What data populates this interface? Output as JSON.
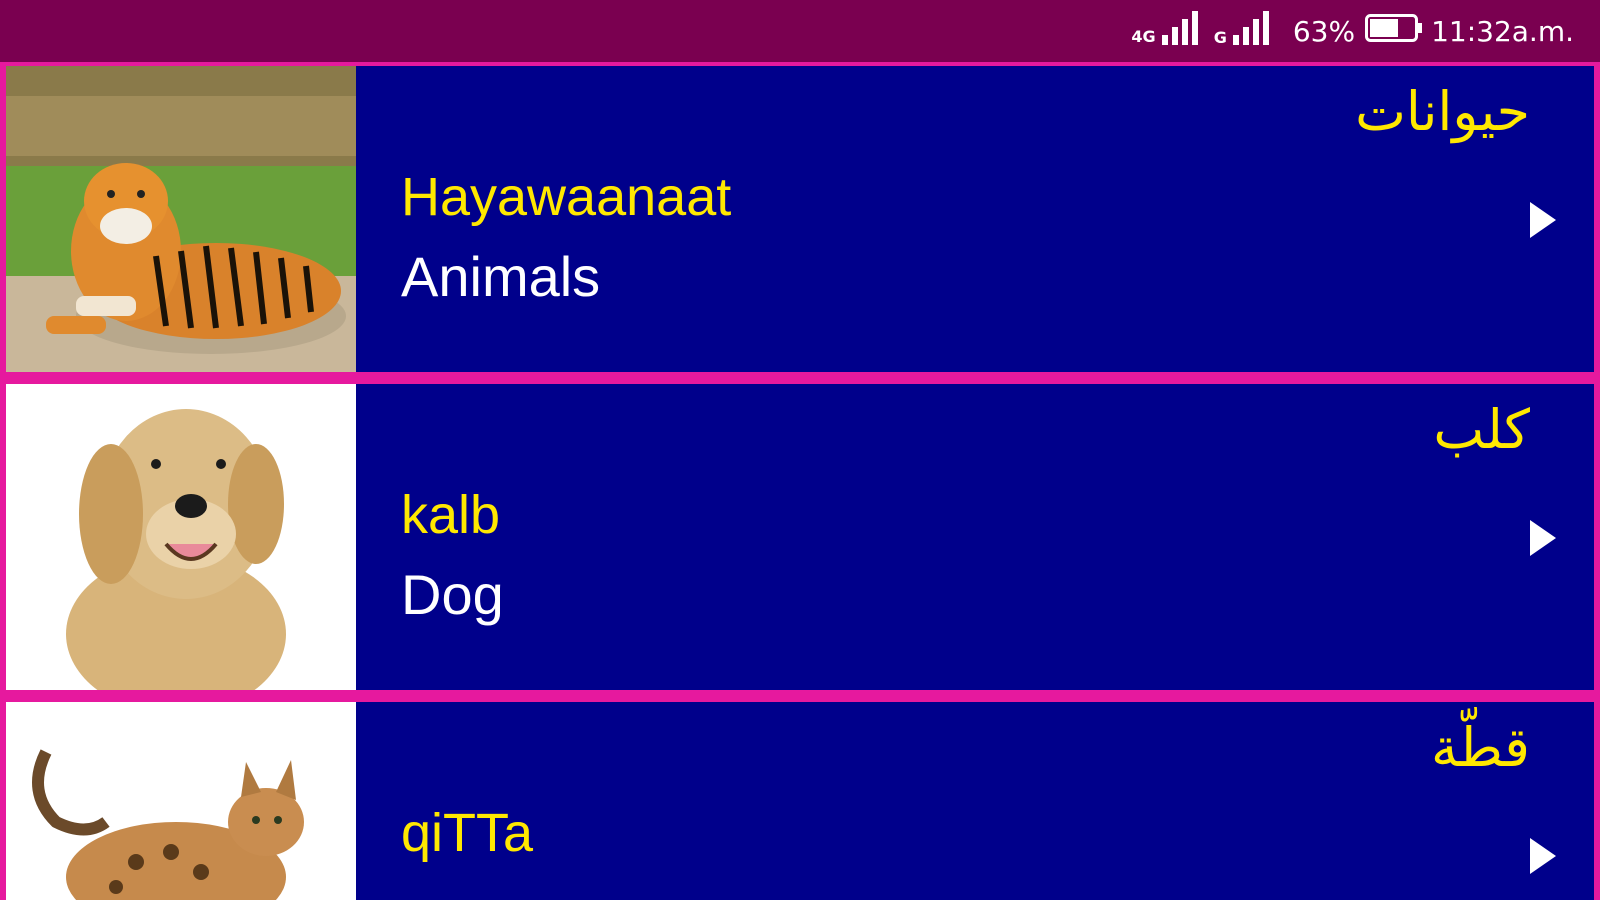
{
  "status_bar": {
    "network_label": "4G",
    "sim_label": "G",
    "battery_percent": "63%",
    "time": "11:32a.m.",
    "background_color": "#7a0050"
  },
  "list": {
    "divider_color": "#e6199e",
    "row_color": "#00008b",
    "arabic_color": "#ffe800",
    "english_color": "#ffffff",
    "items": [
      {
        "image": "tiger-photo",
        "arabic": "حيوانات",
        "transliteration": "Hayawaanaat",
        "english": "Animals",
        "icon": "play-arrow-icon"
      },
      {
        "image": "dog-photo",
        "arabic": "كلب",
        "transliteration": "kalb",
        "english": "Dog",
        "icon": "play-arrow-icon"
      },
      {
        "image": "cat-photo",
        "arabic": "قطّة",
        "transliteration": "qiTTa",
        "english": "",
        "icon": "play-arrow-icon"
      }
    ]
  }
}
